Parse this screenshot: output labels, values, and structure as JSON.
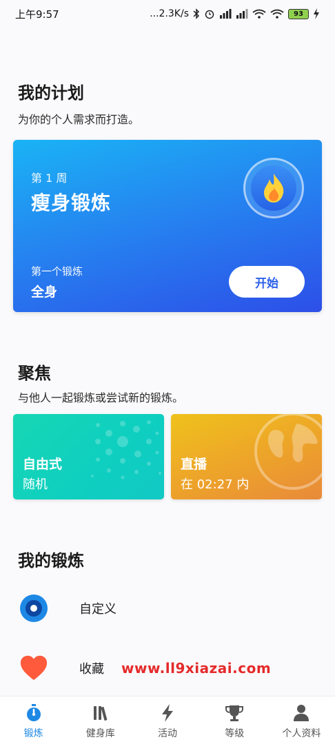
{
  "status_bar": {
    "time": "上午9:57",
    "network_speed": "...2.3K/s",
    "battery": "93"
  },
  "plan_section": {
    "title": "我的计划",
    "subtitle": "为你的个人需求而打造。",
    "card": {
      "week": "第 1 周",
      "name": "瘦身锻炼",
      "first_workout_label": "第一个锻炼",
      "first_workout_value": "全身",
      "start_label": "开始",
      "badge_icon": "flame-icon"
    }
  },
  "focus_section": {
    "title": "聚焦",
    "subtitle": "与他人一起锻炼或尝试新的锻炼。",
    "cards": [
      {
        "title": "自由式",
        "sub": "随机",
        "color": "#17d6b4"
      },
      {
        "title": "直播",
        "sub": "在 02:27 内",
        "color": "#efc21c"
      }
    ]
  },
  "workouts_section": {
    "title": "我的锻炼",
    "items": [
      {
        "label": "自定义",
        "icon": "target-icon",
        "color": "#1e88e5"
      },
      {
        "label": "收藏",
        "icon": "heart-icon",
        "color": "#ff5a3c"
      }
    ]
  },
  "watermark": "www.ll9xiazai.com",
  "bottom_nav": {
    "items": [
      {
        "label": "锻炼",
        "icon": "stopwatch-icon",
        "active": true
      },
      {
        "label": "健身库",
        "icon": "library-icon",
        "active": false
      },
      {
        "label": "活动",
        "icon": "lightning-icon",
        "active": false
      },
      {
        "label": "等级",
        "icon": "trophy-icon",
        "active": false
      },
      {
        "label": "个人资料",
        "icon": "person-icon",
        "active": false
      }
    ],
    "active_color": "#1e88e5"
  }
}
